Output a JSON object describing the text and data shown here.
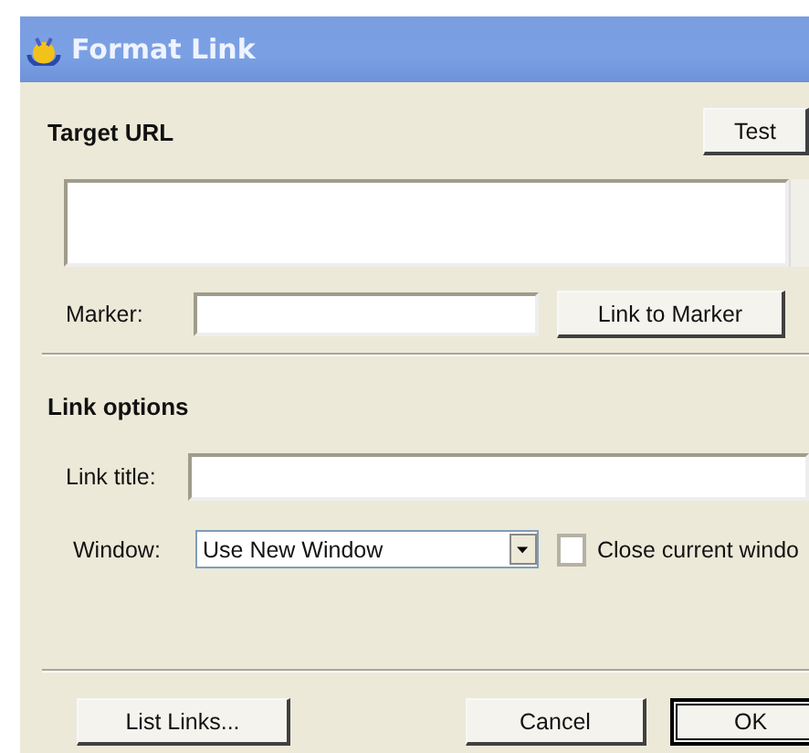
{
  "window": {
    "title": "Format Link"
  },
  "target_url": {
    "heading": "Target URL",
    "test_button": "Test",
    "marker_label": "Marker:",
    "link_to_marker_button": "Link to Marker"
  },
  "link_options": {
    "heading": "Link options",
    "title_label": "Link title:",
    "window_label": "Window:",
    "window_value": "Use New Window",
    "close_current": {
      "label": "Close current windo",
      "checked": false
    }
  },
  "buttons": [
    {
      "label": "List Links...",
      "kind": "normal"
    },
    {
      "label": "Cancel",
      "kind": "normal"
    },
    {
      "label": "OK",
      "kind": "default"
    }
  ]
}
